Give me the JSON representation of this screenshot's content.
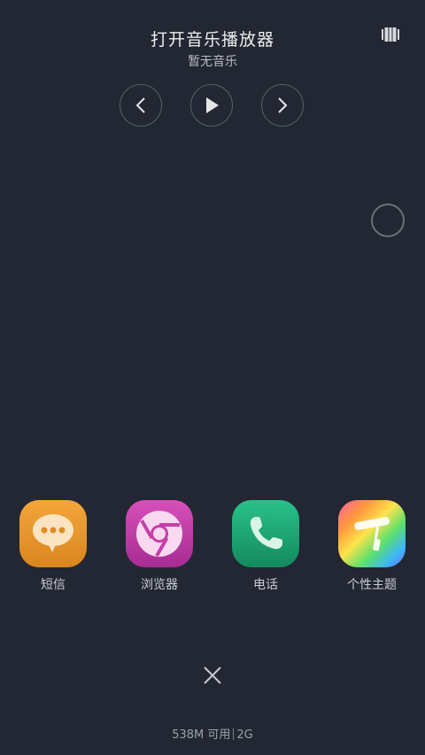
{
  "music": {
    "title": "打开音乐播放器",
    "subtitle": "暂无音乐"
  },
  "icons": {
    "layout": "layout-toggle-icon",
    "prev": "chevron-left-icon",
    "play": "play-icon",
    "next": "chevron-right-icon",
    "float": "floating-ball-icon",
    "close": "close-icon"
  },
  "apps": [
    {
      "label": "短信",
      "icon": "message-icon"
    },
    {
      "label": "浏览器",
      "icon": "browser-icon"
    },
    {
      "label": "电话",
      "icon": "phone-icon"
    },
    {
      "label": "个性主题",
      "icon": "theme-brush-icon"
    }
  ],
  "memory": {
    "available": "538M 可用",
    "total": "2G"
  },
  "colors": {
    "background": "#222733",
    "sms": "#e8952a",
    "browser": "#c43fa8",
    "phone": "#1fa775"
  }
}
